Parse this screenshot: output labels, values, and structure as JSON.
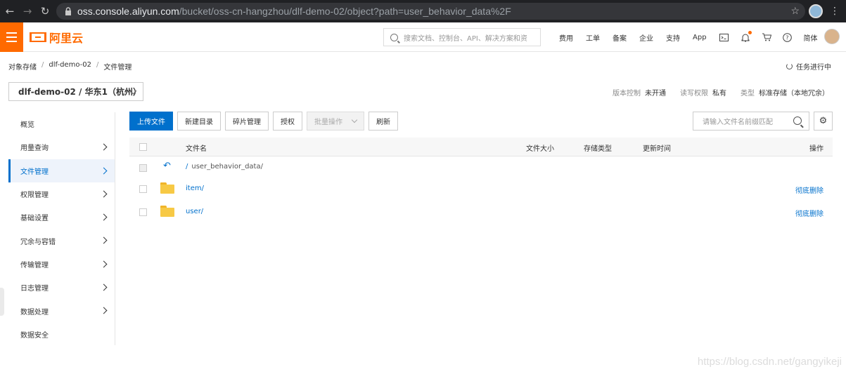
{
  "browser": {
    "url_host": "oss.console.aliyun.com",
    "url_path": "/bucket/oss-cn-hangzhou/dlf-demo-02/object?path=user_behavior_data%2F"
  },
  "topnav": {
    "logo_text": "阿里云",
    "search_placeholder": "搜索文档、控制台、API、解决方案和资",
    "links": [
      "费用",
      "工单",
      "备案",
      "企业",
      "支持",
      "App"
    ],
    "lang": "简体"
  },
  "breadcrumb": [
    "对象存储",
    "dlf-demo-02",
    "文件管理"
  ],
  "task_status": "任务进行中",
  "bucket": {
    "selector": "dlf-demo-02 / 华东1（杭州）",
    "version_label": "版本控制",
    "version_value": "未开通",
    "acl_label": "读写权限",
    "acl_value": "私有",
    "type_label": "类型",
    "type_value": "标准存储（本地冗余）"
  },
  "sidebar": {
    "items": [
      {
        "label": "概览",
        "arrow": false
      },
      {
        "label": "用量查询",
        "arrow": true
      },
      {
        "label": "文件管理",
        "arrow": true,
        "active": true
      },
      {
        "label": "权限管理",
        "arrow": true
      },
      {
        "label": "基础设置",
        "arrow": true
      },
      {
        "label": "冗余与容错",
        "arrow": true
      },
      {
        "label": "传输管理",
        "arrow": true
      },
      {
        "label": "日志管理",
        "arrow": true
      },
      {
        "label": "数据处理",
        "arrow": true
      },
      {
        "label": "数据安全",
        "arrow": false
      }
    ]
  },
  "toolbar": {
    "upload": "上传文件",
    "new_dir": "新建目录",
    "fragments": "碎片管理",
    "authorize": "授权",
    "batch": "批量操作",
    "refresh": "刷新",
    "file_search_placeholder": "请输入文件名前缀匹配"
  },
  "table": {
    "columns": {
      "name": "文件名",
      "size": "文件大小",
      "storage": "存储类型",
      "updated": "更新时间",
      "action": "操作"
    },
    "path_slash": "/",
    "current_path": "user_behavior_data/",
    "rows": [
      {
        "name": "item/",
        "action": "彻底删除"
      },
      {
        "name": "user/",
        "action": "彻底删除"
      }
    ]
  },
  "watermark": "https://blog.csdn.net/gangyikeji"
}
